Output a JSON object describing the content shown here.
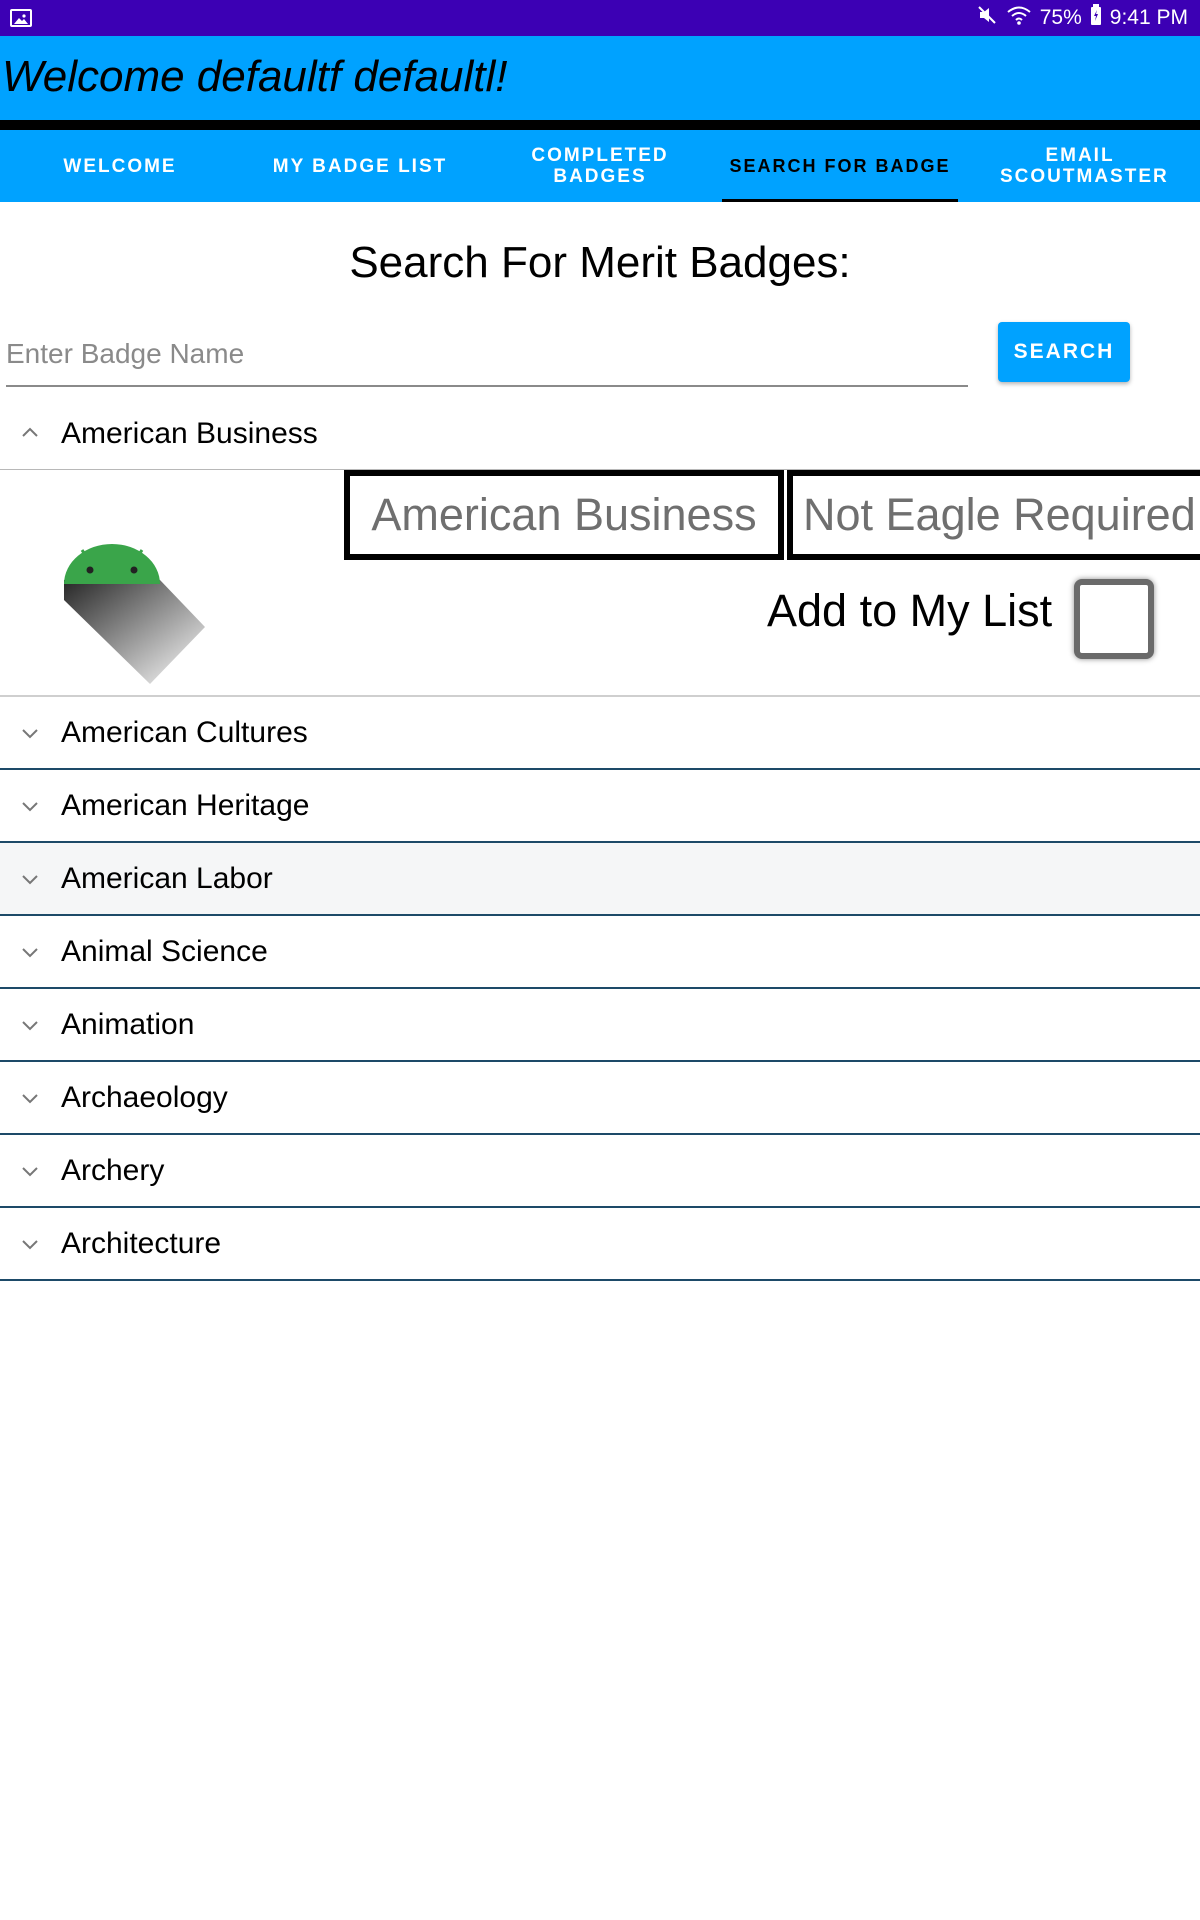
{
  "status_bar": {
    "icons": [
      "gallery-icon",
      "mute-icon",
      "wifi-icon",
      "battery-icon"
    ],
    "battery": "75%",
    "time": "9:41 PM"
  },
  "header": {
    "title": "Welcome defaultf defaultl!"
  },
  "tabs": [
    {
      "label": "WELCOME",
      "active": false
    },
    {
      "label": "MY BADGE LIST",
      "active": false
    },
    {
      "label": "COMPLETED BADGES",
      "active": false
    },
    {
      "label": "SEARCH FOR BADGE",
      "active": true
    },
    {
      "label": "EMAIL SCOUTMASTER",
      "active": false
    }
  ],
  "search": {
    "heading": "Search For Merit Badges:",
    "placeholder": "Enter Badge Name",
    "value": "",
    "button_label": "SEARCH"
  },
  "expanded_badge": {
    "name": "American Business",
    "detail_name": "American Business",
    "eagle_status": "Not Eagle Required",
    "add_label": "Add to My List",
    "checked": false,
    "image_icon": "android-icon"
  },
  "badges": [
    {
      "name": "American Cultures"
    },
    {
      "name": "American Heritage"
    },
    {
      "name": "American Labor"
    },
    {
      "name": "Animal Science"
    },
    {
      "name": "Animation"
    },
    {
      "name": "Archaeology"
    },
    {
      "name": "Archery"
    },
    {
      "name": "Architecture"
    }
  ],
  "colors": {
    "status_bar": "#3c00b4",
    "app_bar": "#00a2ff",
    "divider": "#1d4a68"
  }
}
